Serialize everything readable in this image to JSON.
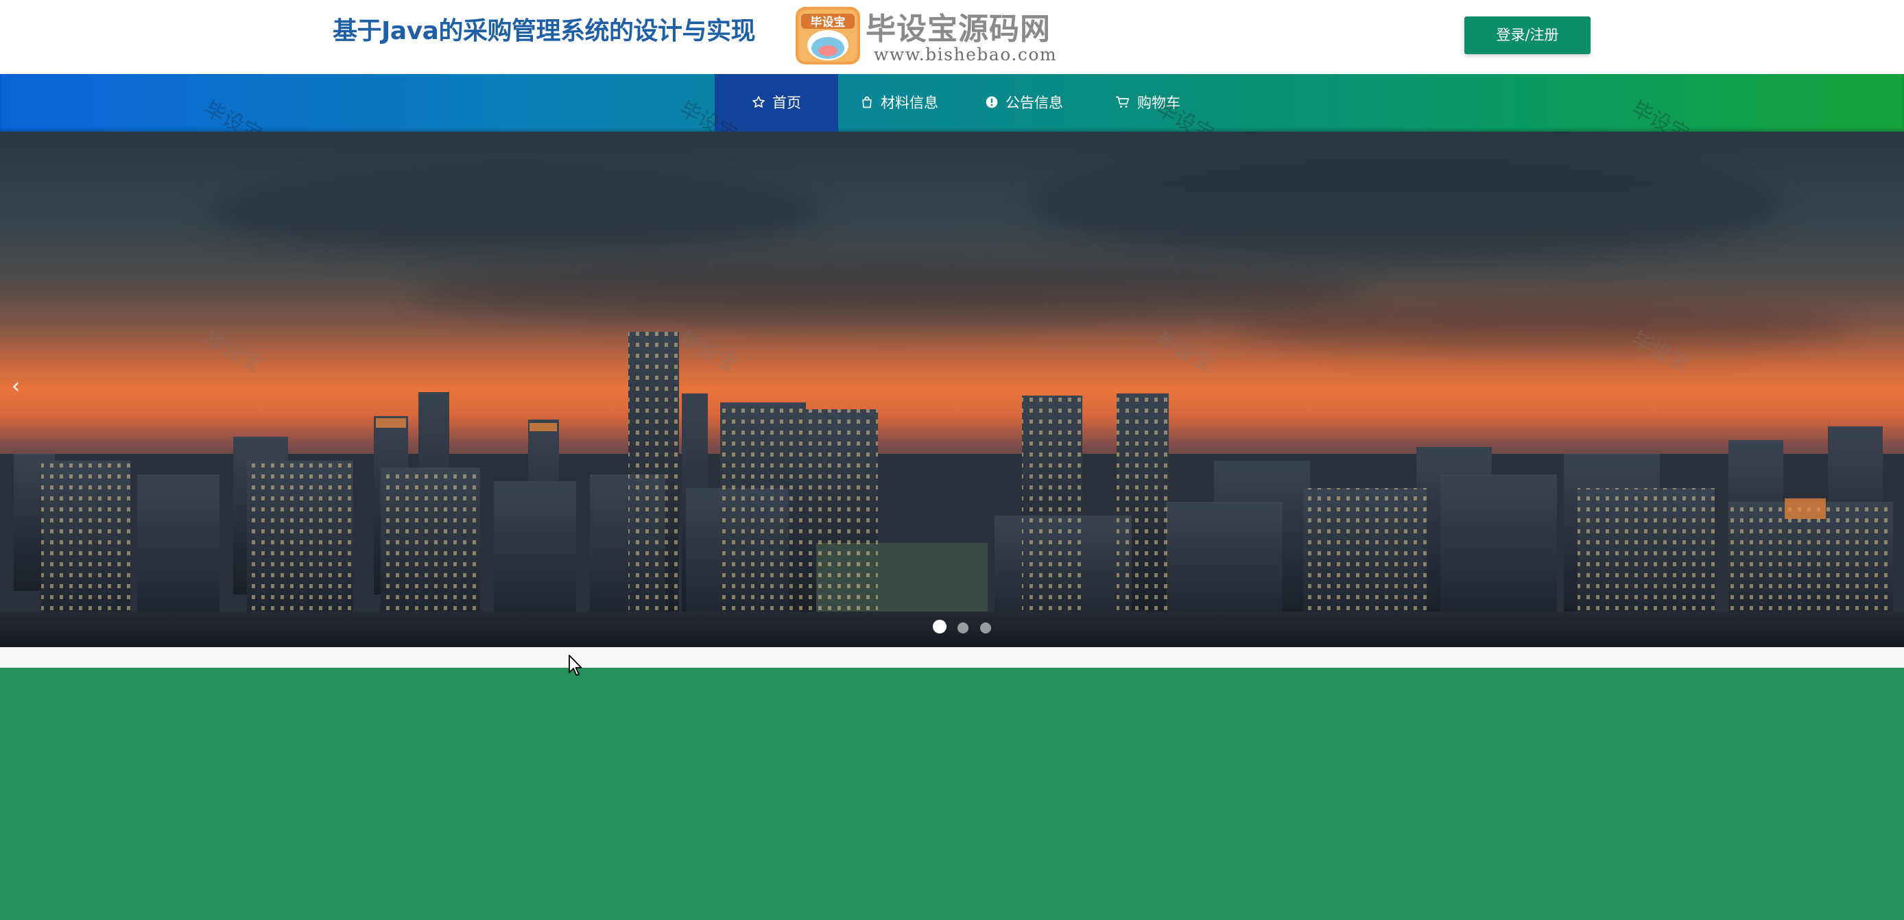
{
  "header": {
    "site_title": "基于Java的采购管理系统的设计与实现",
    "logo": {
      "badge_text": "毕设宝",
      "name": "毕设宝源码网",
      "url": "www.bishebao.com"
    },
    "login_label": "登录/注册"
  },
  "nav": {
    "items": [
      {
        "label": "首页",
        "icon": "star-icon",
        "active": true
      },
      {
        "label": "材料信息",
        "icon": "shopping-bag-icon",
        "active": false
      },
      {
        "label": "公告信息",
        "icon": "info-circle-icon",
        "active": false
      },
      {
        "label": "购物车",
        "icon": "cart-icon",
        "active": false
      }
    ]
  },
  "watermark_text": "毕设宝",
  "carousel": {
    "prev_glyph": "‹",
    "slide_count": 3,
    "active_slide": 1
  },
  "colors": {
    "title_blue": "#1f5fa6",
    "login_green": "#0c8f68",
    "nav_active": "#12439b",
    "section_green": "#259158"
  }
}
